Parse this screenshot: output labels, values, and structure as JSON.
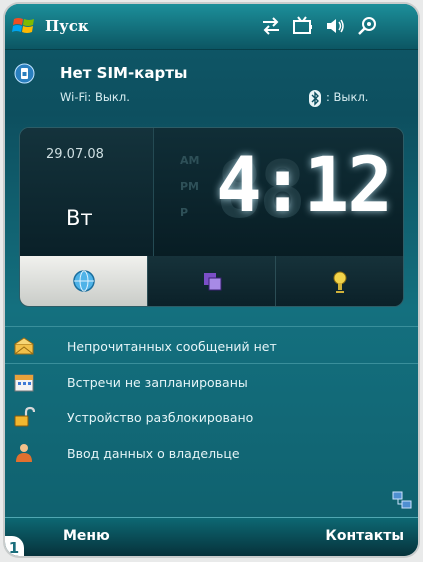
{
  "topbar": {
    "start_label": "Пуск",
    "icons": [
      "start-flag-icon",
      "sync-arrows-icon",
      "battery-icon",
      "speaker-icon",
      "connectivity-icon"
    ]
  },
  "status": {
    "sim_title": "Нет SIM-карты",
    "wifi_text": "Wi-Fi: Выкл.",
    "bluetooth_text": ": Выкл."
  },
  "clock": {
    "date": "29.07.08",
    "weekday": "Вт",
    "time": "4:12",
    "ghost_digits": "88",
    "am_label": "AM",
    "pm_label": "PM",
    "ampm_letter": "P",
    "modes": [
      "globe-icon",
      "windows-icon",
      "alarm-icon"
    ],
    "active_mode": 0
  },
  "today_items": [
    {
      "icon": "envelope-icon",
      "label": "Непрочитанных сообщений нет"
    },
    {
      "icon": "calendar-icon",
      "label": "Встречи не запланированы"
    },
    {
      "icon": "padlock-icon",
      "label": "Устройство разблокировано"
    },
    {
      "icon": "owner-icon",
      "label": "Ввод данных о владельце"
    }
  ],
  "softkeys": {
    "left": "Меню",
    "right": "Контакты"
  },
  "corner_badge": "1",
  "colors": {
    "accent": "#14707f",
    "topbar": "#1c8f9a",
    "softbar": "#0d6873",
    "text": "#ffffff"
  }
}
